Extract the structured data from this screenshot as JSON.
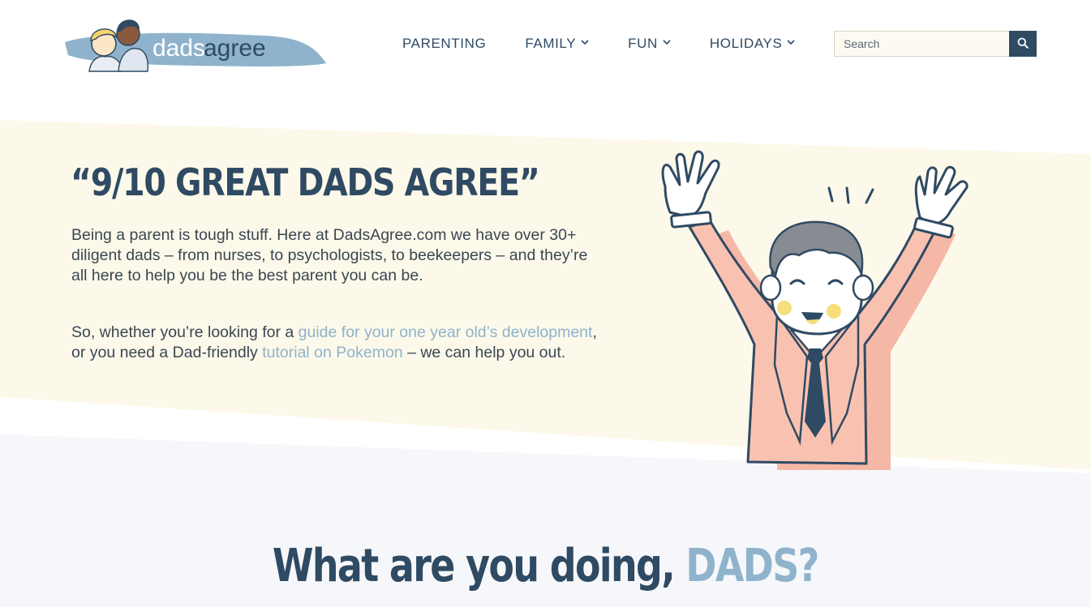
{
  "brand": {
    "logo_text_dads": "dads",
    "logo_text_agree": "agree",
    "colors": {
      "navy": "#2f4a63",
      "accent": "#8fb3cc",
      "cream": "#fcf9ea",
      "page_bg_lower": "#f6f7fa"
    }
  },
  "nav": {
    "items": [
      {
        "label": "PARENTING",
        "has_dropdown": false
      },
      {
        "label": "FAMILY",
        "has_dropdown": true
      },
      {
        "label": "FUN",
        "has_dropdown": true
      },
      {
        "label": "HOLIDAYS",
        "has_dropdown": true
      }
    ],
    "dropdown_glyph": "⌄"
  },
  "search": {
    "placeholder": "Search",
    "icon": "search-icon"
  },
  "hero": {
    "title": "“9/10 GREAT DADS AGREE”",
    "paragraph1": "Being a parent is tough stuff.  Here at DadsAgree.com we have over 30+ diligent dads – from nurses, to psychologists, to beekeepers – and they’re all here to help you be the best parent you can be.",
    "paragraph2_prefix": "So, whether you’re looking for a ",
    "paragraph2_link1": "guide for your one year old’s development",
    "paragraph2_middle": ", or you need a Dad-friendly ",
    "paragraph2_link2": "tutorial on Pokemon",
    "paragraph2_suffix": " – we can help you out.",
    "illustration": "cheering-dad-illustration"
  },
  "section": {
    "title_main": "What are you doing, ",
    "title_accent": "DADS?"
  }
}
